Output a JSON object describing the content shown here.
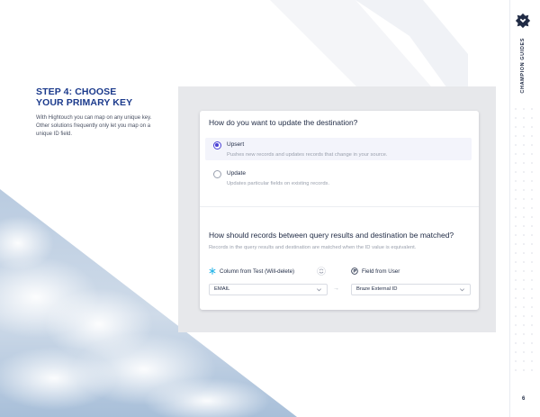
{
  "sidebar": {
    "brand_label": "CHAMPION GUIDES",
    "page_number": "6"
  },
  "intro": {
    "title_line1": "STEP 4: CHOOSE",
    "title_line2": "YOUR PRIMARY KEY",
    "body": "With Hightouch you can map on any unique key. Other solutions frequently only let you map on a unique ID field."
  },
  "form": {
    "question1": "How do you want to update the destination?",
    "options": [
      {
        "label": "Upsert",
        "description": "Pushes new records and updates records that change in your source.",
        "selected": true
      },
      {
        "label": "Update",
        "description": "Updates particular fields on existing records.",
        "selected": false
      }
    ],
    "question2": "How should records between query results and destination be matched?",
    "question2_desc": "Records in the query results and destination are matched when the ID value is equivalent.",
    "source_column_label": "Column from Test (Will-delete)",
    "dest_field_label": "Field from User",
    "source_value": "EMAIL",
    "dest_value": "Braze External ID",
    "arrow": "→"
  },
  "colors": {
    "accent": "#4b42d6",
    "title_blue": "#1b3a8c",
    "panel_gray": "#e7e8eb"
  },
  "icons": [
    "champion-logo-icon",
    "snowflake-icon",
    "sync-icon",
    "braze-icon",
    "chevron-down-icon"
  ]
}
